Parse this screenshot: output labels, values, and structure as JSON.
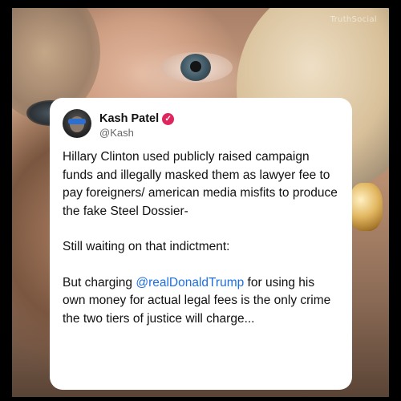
{
  "watermark": "TruthSocial",
  "post": {
    "author_name": "Kash Patel",
    "author_handle": "@Kash",
    "verified_icon": "check-badge-icon",
    "para1": "Hillary Clinton used publicly raised campaign funds and illegally masked them as lawyer fee to pay foreigners/ american media misfits to produce the fake Steel Dossier-",
    "para2": "Still waiting on that indictment:",
    "para3_pre": "But charging ",
    "para3_mention": "@realDonaldTrump",
    "para3_post": " for using his own money for actual legal fees is the only crime the two tiers of justice will charge..."
  },
  "colors": {
    "verified_badge": "#e0245e",
    "mention": "#1d6fe0",
    "card_background": "#ffffff",
    "frame_background": "#000000"
  }
}
